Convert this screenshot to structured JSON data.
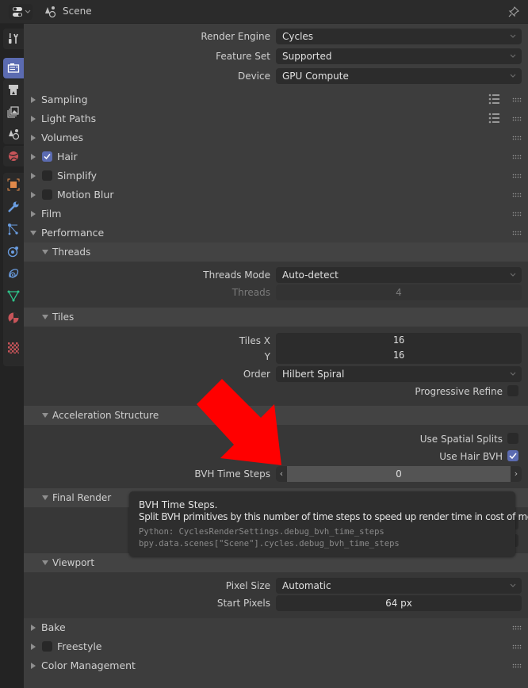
{
  "header": {
    "title": "Scene",
    "editor_type_icon": "properties-editor-icon",
    "context_icon": "scene-icon",
    "pin_icon": "pin-icon"
  },
  "sidebar_tabs": [
    {
      "name": "tool",
      "icon": "tool-icon"
    },
    {
      "name": "render",
      "icon": "render-icon",
      "active": true
    },
    {
      "name": "output",
      "icon": "output-icon"
    },
    {
      "name": "view-layer",
      "icon": "view-layer-icon"
    },
    {
      "name": "scene",
      "icon": "scene-icon"
    },
    {
      "name": "world",
      "icon": "world-icon"
    },
    {
      "name": "object",
      "icon": "object-icon"
    },
    {
      "name": "modifiers",
      "icon": "wrench-icon"
    },
    {
      "name": "particles",
      "icon": "particles-icon"
    },
    {
      "name": "physics",
      "icon": "physics-icon"
    },
    {
      "name": "constraints",
      "icon": "constraints-icon"
    },
    {
      "name": "data",
      "icon": "mesh-data-icon"
    },
    {
      "name": "material",
      "icon": "material-icon"
    },
    {
      "name": "texture",
      "icon": "texture-icon"
    }
  ],
  "top_props": {
    "render_engine": {
      "label": "Render Engine",
      "value": "Cycles"
    },
    "feature_set": {
      "label": "Feature Set",
      "value": "Supported"
    },
    "device": {
      "label": "Device",
      "value": "GPU Compute"
    }
  },
  "panels": {
    "sampling": "Sampling",
    "light_paths": "Light Paths",
    "volumes": "Volumes",
    "hair": {
      "label": "Hair",
      "enabled": true
    },
    "simplify": {
      "label": "Simplify",
      "enabled": false
    },
    "motion_blur": {
      "label": "Motion Blur",
      "enabled": false
    },
    "film": "Film",
    "performance": "Performance",
    "bake": "Bake",
    "freestyle": {
      "label": "Freestyle",
      "enabled": false
    },
    "color_management": "Color Management"
  },
  "performance": {
    "threads": {
      "title": "Threads",
      "mode_label": "Threads Mode",
      "mode_value": "Auto-detect",
      "threads_label": "Threads",
      "threads_value": "4"
    },
    "tiles": {
      "title": "Tiles",
      "tiles_x_label": "Tiles X",
      "tiles_x_value": "16",
      "y_label": "Y",
      "y_value": "16",
      "order_label": "Order",
      "order_value": "Hilbert Spiral",
      "progressive_refine_label": "Progressive Refine",
      "progressive_refine": false
    },
    "acceleration": {
      "title": "Acceleration Structure",
      "spatial_splits_label": "Use Spatial Splits",
      "spatial_splits": false,
      "hair_bvh_label": "Use Hair BVH",
      "hair_bvh": true,
      "bvh_time_steps_label": "BVH Time Steps",
      "bvh_time_steps_value": "0"
    },
    "final_render": {
      "title": "Final Render"
    },
    "viewport": {
      "title": "Viewport",
      "pixel_size_label": "Pixel Size",
      "pixel_size_value": "Automatic",
      "start_pixels_label": "Start Pixels",
      "start_pixels_value": "64 px"
    }
  },
  "tooltip": {
    "title": "BVH Time Steps.",
    "description": "Split BVH primitives by this number of time steps to speed up render time in cost of memory.",
    "python": "Python: CyclesRenderSettings.debug_bvh_time_steps",
    "path": "bpy.data.scenes[\"Scene\"].cycles.debug_bvh_time_steps"
  },
  "annotation": {
    "type": "arrow",
    "color": "#ff0000",
    "points_to": "BVH Time Steps"
  },
  "colors": {
    "accent": "#5b6bb1",
    "panel_bg": "#3d3d3d",
    "subpanel_bg": "#373737",
    "field_bg": "#2c2c2c"
  }
}
